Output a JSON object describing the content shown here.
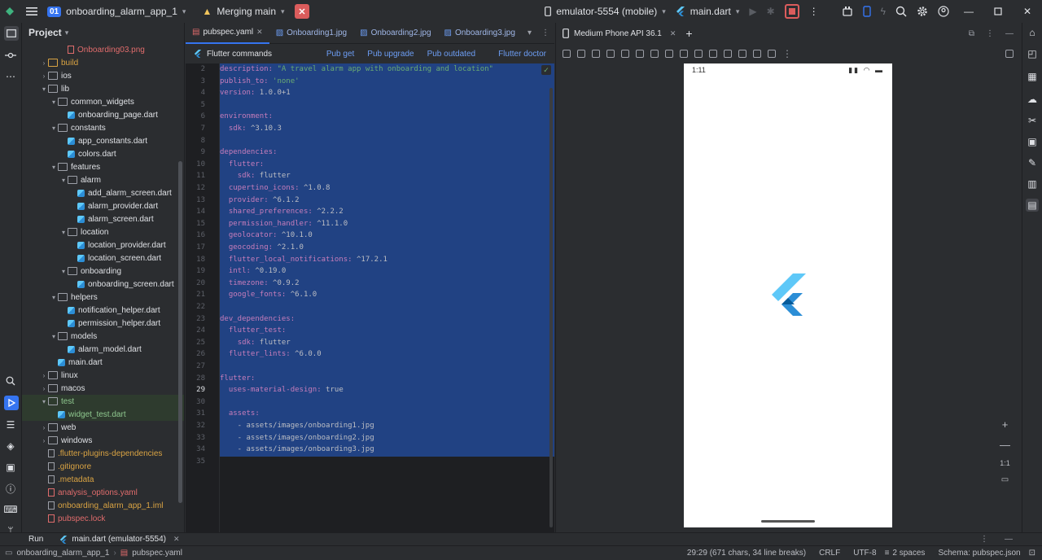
{
  "titlebar": {
    "project_badge": "01",
    "project_name": "onboarding_alarm_app_1",
    "vcs_label": "Merging main",
    "device": "emulator-5554 (mobile)",
    "run_config": "main.dart"
  },
  "project_panel": {
    "title": "Project",
    "tree": [
      {
        "label": "Onboarding03.png",
        "depth": 4,
        "type": "file",
        "color": "red",
        "expanded": false
      },
      {
        "label": "build",
        "depth": 2,
        "type": "folder",
        "color": "orange",
        "expanded": false
      },
      {
        "label": "ios",
        "depth": 2,
        "type": "folder",
        "expanded": false
      },
      {
        "label": "lib",
        "depth": 2,
        "type": "folder",
        "expanded": true
      },
      {
        "label": "common_widgets",
        "depth": 3,
        "type": "folder",
        "expanded": true
      },
      {
        "label": "onboarding_page.dart",
        "depth": 4,
        "type": "dart"
      },
      {
        "label": "constants",
        "depth": 3,
        "type": "folder",
        "expanded": true
      },
      {
        "label": "app_constants.dart",
        "depth": 4,
        "type": "dart"
      },
      {
        "label": "colors.dart",
        "depth": 4,
        "type": "dart"
      },
      {
        "label": "features",
        "depth": 3,
        "type": "folder",
        "expanded": true
      },
      {
        "label": "alarm",
        "depth": 4,
        "type": "folder",
        "expanded": true
      },
      {
        "label": "add_alarm_screen.dart",
        "depth": 5,
        "type": "dart"
      },
      {
        "label": "alarm_provider.dart",
        "depth": 5,
        "type": "dart"
      },
      {
        "label": "alarm_screen.dart",
        "depth": 5,
        "type": "dart"
      },
      {
        "label": "location",
        "depth": 4,
        "type": "folder",
        "expanded": true
      },
      {
        "label": "location_provider.dart",
        "depth": 5,
        "type": "dart"
      },
      {
        "label": "location_screen.dart",
        "depth": 5,
        "type": "dart"
      },
      {
        "label": "onboarding",
        "depth": 4,
        "type": "folder",
        "expanded": true
      },
      {
        "label": "onboarding_screen.dart",
        "depth": 5,
        "type": "dart"
      },
      {
        "label": "helpers",
        "depth": 3,
        "type": "folder",
        "expanded": true
      },
      {
        "label": "notification_helper.dart",
        "depth": 4,
        "type": "dart"
      },
      {
        "label": "permission_helper.dart",
        "depth": 4,
        "type": "dart"
      },
      {
        "label": "models",
        "depth": 3,
        "type": "folder",
        "expanded": true
      },
      {
        "label": "alarm_model.dart",
        "depth": 4,
        "type": "dart"
      },
      {
        "label": "main.dart",
        "depth": 3,
        "type": "dart"
      },
      {
        "label": "linux",
        "depth": 2,
        "type": "folder",
        "expanded": false
      },
      {
        "label": "macos",
        "depth": 2,
        "type": "folder",
        "expanded": false
      },
      {
        "label": "test",
        "depth": 2,
        "type": "folder",
        "expanded": true,
        "highlight": true
      },
      {
        "label": "widget_test.dart",
        "depth": 3,
        "type": "dart",
        "highlight": true
      },
      {
        "label": "web",
        "depth": 2,
        "type": "folder",
        "expanded": false
      },
      {
        "label": "windows",
        "depth": 2,
        "type": "folder",
        "expanded": false
      },
      {
        "label": ".flutter-plugins-dependencies",
        "depth": 2,
        "type": "file",
        "color": "orange"
      },
      {
        "label": ".gitignore",
        "depth": 2,
        "type": "file",
        "color": "orange"
      },
      {
        "label": ".metadata",
        "depth": 2,
        "type": "file",
        "color": "orange"
      },
      {
        "label": "analysis_options.yaml",
        "depth": 2,
        "type": "file",
        "color": "red"
      },
      {
        "label": "onboarding_alarm_app_1.iml",
        "depth": 2,
        "type": "file",
        "color": "orange"
      },
      {
        "label": "pubspec.lock",
        "depth": 2,
        "type": "file",
        "color": "red"
      }
    ]
  },
  "editor": {
    "tabs": [
      {
        "label": "pubspec.yaml",
        "active": true
      },
      {
        "label": "Onboarding1.jpg",
        "active": false
      },
      {
        "label": "Onboarding2.jpg",
        "active": false
      },
      {
        "label": "Onboarding3.jpg",
        "active": false
      }
    ],
    "pub_bar": {
      "title": "Flutter commands",
      "links": [
        "Pub get",
        "Pub upgrade",
        "Pub outdated",
        "Flutter doctor"
      ]
    },
    "lines": [
      {
        "n": "2",
        "text": "description: \"A travel alarm app with onboarding and location\""
      },
      {
        "n": "3",
        "text": "publish_to: 'none'"
      },
      {
        "n": "4",
        "text": "version: 1.0.0+1"
      },
      {
        "n": "5",
        "text": ""
      },
      {
        "n": "6",
        "text": "environment:"
      },
      {
        "n": "7",
        "text": "  sdk: ^3.10.3"
      },
      {
        "n": "8",
        "text": ""
      },
      {
        "n": "9",
        "text": "dependencies:"
      },
      {
        "n": "10",
        "text": "  flutter:"
      },
      {
        "n": "11",
        "text": "    sdk: flutter"
      },
      {
        "n": "12",
        "text": "  cupertino_icons: ^1.0.8"
      },
      {
        "n": "13",
        "text": "  provider: ^6.1.2"
      },
      {
        "n": "14",
        "text": "  shared_preferences: ^2.2.2"
      },
      {
        "n": "15",
        "text": "  permission_handler: ^11.1.0"
      },
      {
        "n": "16",
        "text": "  geolocator: ^10.1.0"
      },
      {
        "n": "17",
        "text": "  geocoding: ^2.1.0"
      },
      {
        "n": "18",
        "text": "  flutter_local_notifications: ^17.2.1"
      },
      {
        "n": "19",
        "text": "  intl: ^0.19.0"
      },
      {
        "n": "20",
        "text": "  timezone: ^0.9.2"
      },
      {
        "n": "21",
        "text": "  google_fonts: ^6.1.0"
      },
      {
        "n": "22",
        "text": ""
      },
      {
        "n": "23",
        "text": "dev_dependencies:"
      },
      {
        "n": "24",
        "text": "  flutter_test:"
      },
      {
        "n": "25",
        "text": "    sdk: flutter"
      },
      {
        "n": "26",
        "text": "  flutter_lints: ^6.0.0"
      },
      {
        "n": "27",
        "text": ""
      },
      {
        "n": "28",
        "text": "flutter:"
      },
      {
        "n": "29",
        "text": "  uses-material-design: true"
      },
      {
        "n": "30",
        "text": ""
      },
      {
        "n": "31",
        "text": "  assets:"
      },
      {
        "n": "32",
        "text": "    - assets/images/onboarding1.jpg"
      },
      {
        "n": "33",
        "text": "    - assets/images/onboarding2.jpg"
      },
      {
        "n": "34",
        "text": "    - assets/images/onboarding3.jpg"
      },
      {
        "n": "35",
        "text": ""
      }
    ],
    "current_line": "29"
  },
  "emulator": {
    "title": "Medium Phone API 36.1",
    "phone_time": "1:11",
    "zoom_ratio": "1:1"
  },
  "runbar": {
    "label": "Run",
    "config": "main.dart (emulator-5554)"
  },
  "statusbar": {
    "breadcrumb_project": "onboarding_alarm_app_1",
    "breadcrumb_file": "pubspec.yaml",
    "position": "29:29 (671 chars, 34 line breaks)",
    "line_sep": "CRLF",
    "encoding": "UTF-8",
    "indent": "2 spaces",
    "schema": "Schema: pubspec.json"
  },
  "colors": {
    "accent": "#3574f0",
    "selection": "#214283",
    "stop": "#db5c5c"
  }
}
